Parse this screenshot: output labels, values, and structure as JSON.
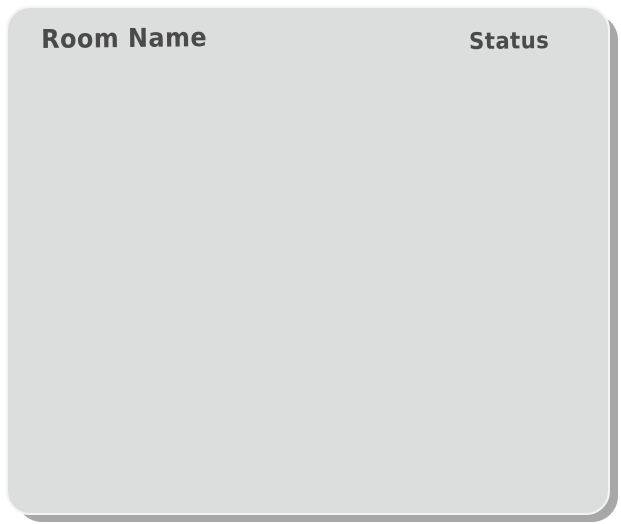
{
  "room_list": {
    "columns": {
      "room_name": "Room Name",
      "status": "Status"
    },
    "rows": []
  },
  "colors": {
    "panel_background": "#dcdedd",
    "panel_border": "#f4f4f4",
    "panel_shadow": "#a7a7a7",
    "header_text": "#4a4a4a"
  }
}
